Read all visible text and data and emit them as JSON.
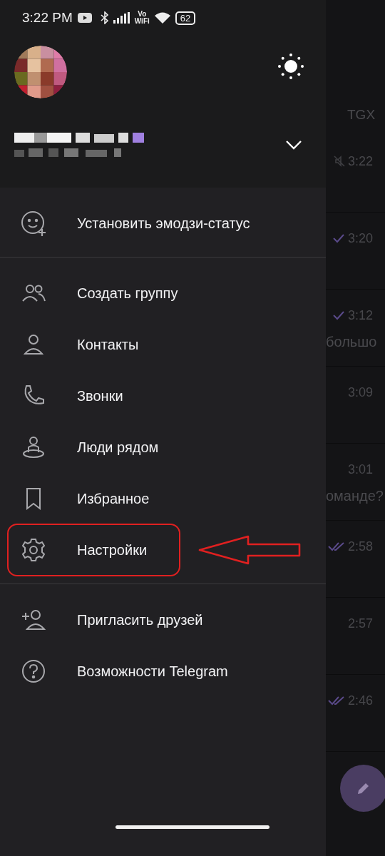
{
  "status_bar": {
    "time": "3:22 PM",
    "volte": "Vo",
    "volte_sub": "WiFi",
    "battery": "62"
  },
  "drawer": {
    "sections": [
      {
        "items": [
          {
            "label": "Установить эмодзи-статус",
            "highlighted": false
          }
        ]
      },
      {
        "items": [
          {
            "label": "Создать группу",
            "highlighted": false
          },
          {
            "label": "Контакты",
            "highlighted": false
          },
          {
            "label": "Звонки",
            "highlighted": false
          },
          {
            "label": "Люди рядом",
            "highlighted": false
          },
          {
            "label": "Избранное",
            "highlighted": false
          },
          {
            "label": "Настройки",
            "highlighted": true
          }
        ]
      },
      {
        "items": [
          {
            "label": "Пригласить друзей",
            "highlighted": false
          },
          {
            "label": "Возможности Telegram",
            "highlighted": false
          }
        ]
      }
    ]
  },
  "chat_list": {
    "header": "TGX",
    "rows": [
      {
        "kind": "muted",
        "time": "3:22"
      },
      {
        "kind": "sent",
        "time": "3:20"
      },
      {
        "kind": "sent",
        "time": "3:12",
        "snippet": "большо"
      },
      {
        "kind": "plain",
        "time": "3:09"
      },
      {
        "kind": "plain",
        "time": "3:01",
        "snippet": "оманде?"
      },
      {
        "kind": "read",
        "time": "2:58"
      },
      {
        "kind": "plain",
        "time": "2:57"
      },
      {
        "kind": "read",
        "time": "2:46"
      }
    ]
  }
}
